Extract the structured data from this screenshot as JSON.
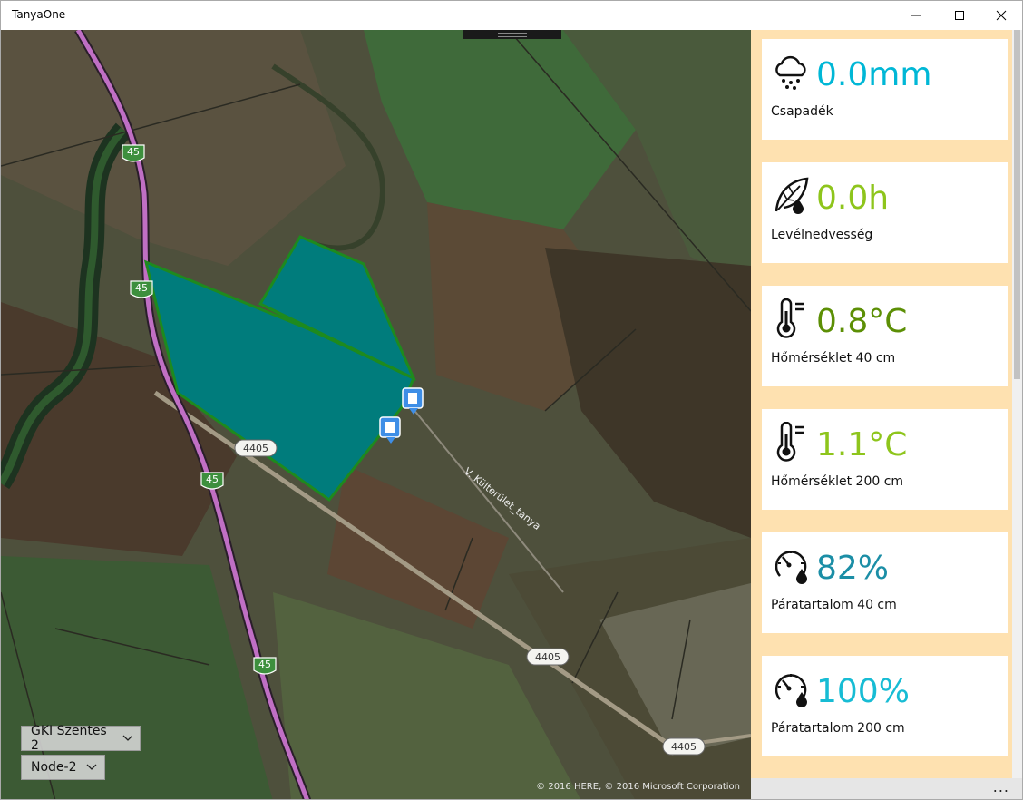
{
  "window": {
    "title": "TanyaOne"
  },
  "map": {
    "road_shields": [
      "45",
      "45",
      "45",
      "45"
    ],
    "road_labels": [
      "4405",
      "4405",
      "4405"
    ],
    "street_label": "V. Külterület_tanya",
    "copyright": "© 2016 HERE, © 2016 Microsoft Corporation"
  },
  "controls": {
    "station_select": "GKI Szentes 2",
    "node_select": "Node-2"
  },
  "cards": [
    {
      "icon": "rain-cloud-icon",
      "value": "0.0mm",
      "label": "Csapadék",
      "color": "#00b7d6"
    },
    {
      "icon": "leaf-wetness-icon",
      "value": "0.0h",
      "label": "Levélnedvesség",
      "color": "#8ec51c"
    },
    {
      "icon": "thermometer-icon",
      "value": "0.8°C",
      "label": "Hőmérséklet 40 cm",
      "color": "#5c8f05"
    },
    {
      "icon": "thermometer-icon",
      "value": "1.1°C",
      "label": "Hőmérséklet 200 cm",
      "color": "#8ec51c"
    },
    {
      "icon": "humidity-gauge-icon",
      "value": "82%",
      "label": "Páratartalom 40 cm",
      "color": "#1b8ea6"
    },
    {
      "icon": "humidity-gauge-icon",
      "value": "100%",
      "label": "Páratartalom 200 cm",
      "color": "#17bcd4"
    }
  ],
  "commandbar": {
    "more": "..."
  }
}
